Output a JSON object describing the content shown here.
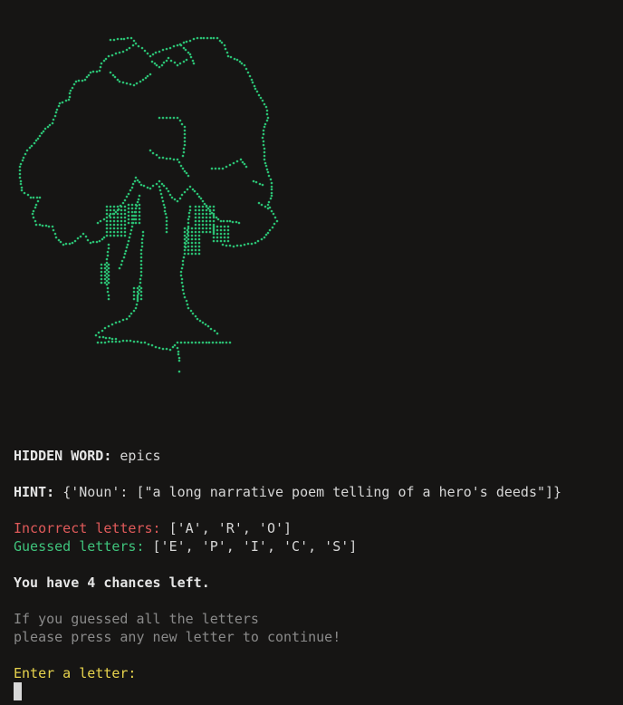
{
  "art": {
    "name": "hangman-tree-ascii-art",
    "color": "#2bbf73"
  },
  "hidden_word": {
    "label": "HIDDEN WORD:",
    "value": "epics"
  },
  "hint": {
    "label": "HINT:",
    "value": "{'Noun': [\"a long narrative poem telling of a hero's deeds\"]}"
  },
  "incorrect": {
    "label": "Incorrect letters:",
    "value": "['A', 'R', 'O']"
  },
  "guessed": {
    "label": "Guessed letters:",
    "value": "['E', 'P', 'I', 'C', 'S']"
  },
  "chances": {
    "text": "You have 4 chances left."
  },
  "info": {
    "line1": "If you guessed all the letters",
    "line2": "please press any new letter to continue!"
  },
  "prompt": {
    "text": "Enter a letter:"
  },
  "colors": {
    "background": "#161514",
    "red": "#e05a5a",
    "green": "#3fc47c",
    "yellow": "#e8d44d"
  }
}
